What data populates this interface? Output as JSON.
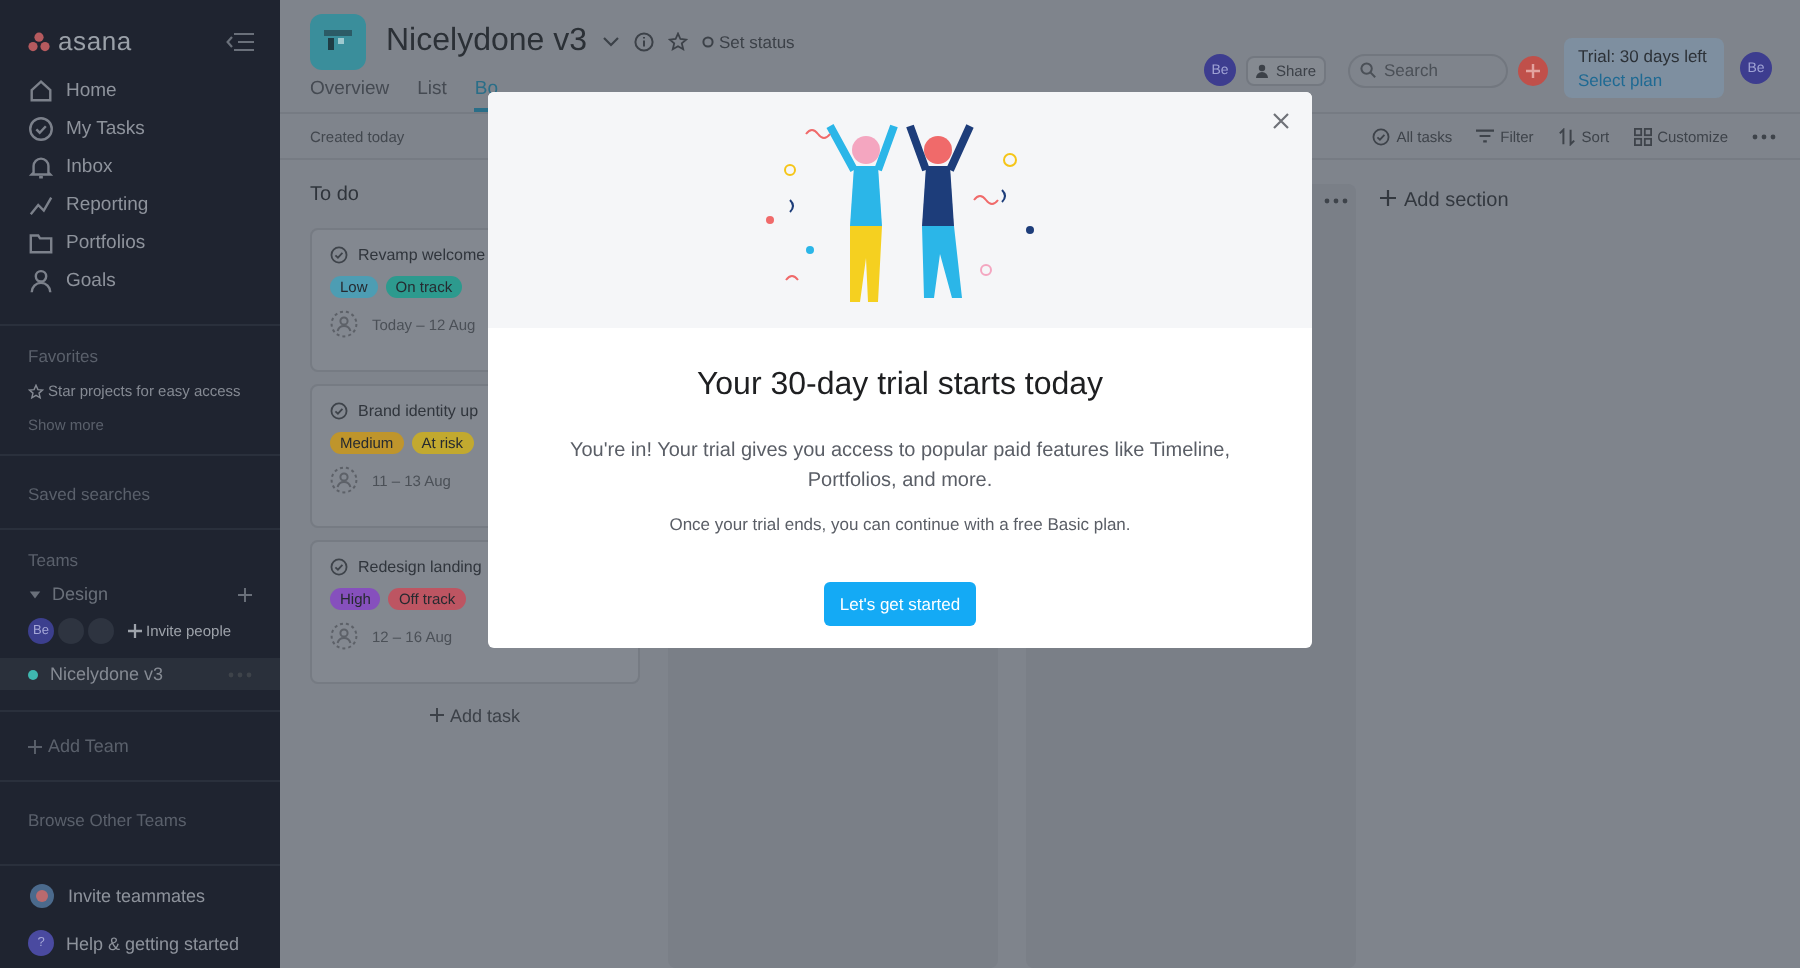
{
  "sidebar": {
    "logo": "asana",
    "nav": [
      {
        "kind": "home",
        "label": "Home"
      },
      {
        "kind": "tasks",
        "label": "My Tasks"
      },
      {
        "kind": "inbox",
        "label": "Inbox"
      },
      {
        "kind": "reporting",
        "label": "Reporting"
      },
      {
        "kind": "portfolios",
        "label": "Portfolios"
      },
      {
        "kind": "goals",
        "label": "Goals"
      }
    ],
    "favorites": {
      "heading": "Favorites",
      "hint": "Star projects for easy access",
      "show_more": "Show more"
    },
    "saved_searches": "Saved searches",
    "teams": {
      "heading": "Teams",
      "team": {
        "name": "Design",
        "expanded": true,
        "members": [
          {
            "kind": "initials",
            "text": "Be"
          },
          {
            "kind": "blank"
          },
          {
            "kind": "blank"
          }
        ],
        "invite": "Invite people"
      },
      "projects": [
        {
          "name": "Nicelydone v3",
          "selected": true,
          "color": "#3fb8b0"
        }
      ]
    },
    "add_team": "Add Team",
    "browse_teams": "Browse Other Teams",
    "invite_teammates": "Invite teammates",
    "help": "Help & getting started",
    "help_badge": "?"
  },
  "header": {
    "project_title": "Nicelydone v3",
    "set_status": "Set status",
    "member_avatar": "Be",
    "share": "Share",
    "search": {
      "placeholder": "Search"
    },
    "trial": {
      "text": "Trial: 30 days left",
      "link": "Select plan"
    },
    "user_avatar": "Be",
    "tabs": [
      {
        "label": "Overview",
        "selected": false
      },
      {
        "label": "List",
        "selected": false
      },
      {
        "label": "Bo",
        "selected": true
      }
    ]
  },
  "toolbar": {
    "created": "Created today",
    "actions": [
      {
        "kind": "check",
        "label": "All tasks"
      },
      {
        "kind": "filter",
        "label": "Filter"
      },
      {
        "kind": "sort",
        "label": "Sort"
      },
      {
        "kind": "customize",
        "label": "Customize"
      }
    ]
  },
  "board": {
    "column": {
      "title": "To do",
      "cards": [
        {
          "title": "Revamp welcome",
          "tags": [
            {
              "label": "Low",
              "color": "#4d9db3"
            },
            {
              "label": "On track",
              "color": "#2d9a8e"
            }
          ],
          "dates": "Today – 12 Aug"
        },
        {
          "title": "Brand identity up",
          "tags": [
            {
              "label": "Medium",
              "color": "#bf952c"
            },
            {
              "label": "At risk",
              "color": "#c2a92f"
            }
          ],
          "dates": "11 – 13 Aug"
        },
        {
          "title": "Redesign landing",
          "tags": [
            {
              "label": "High",
              "color": "#8650bd"
            },
            {
              "label": "Off track",
              "color": "#bd5562"
            }
          ],
          "dates": "12 – 16 Aug"
        }
      ],
      "add_task": "Add task"
    },
    "add_section": "Add section"
  },
  "modal": {
    "title": "Your 30-day trial starts today",
    "body": "You're in! Your trial gives you access to popular paid features like Timeline, Portfolios, and more.",
    "note": "Once your trial ends, you can continue with a free Basic plan.",
    "button": "Let's get started"
  }
}
